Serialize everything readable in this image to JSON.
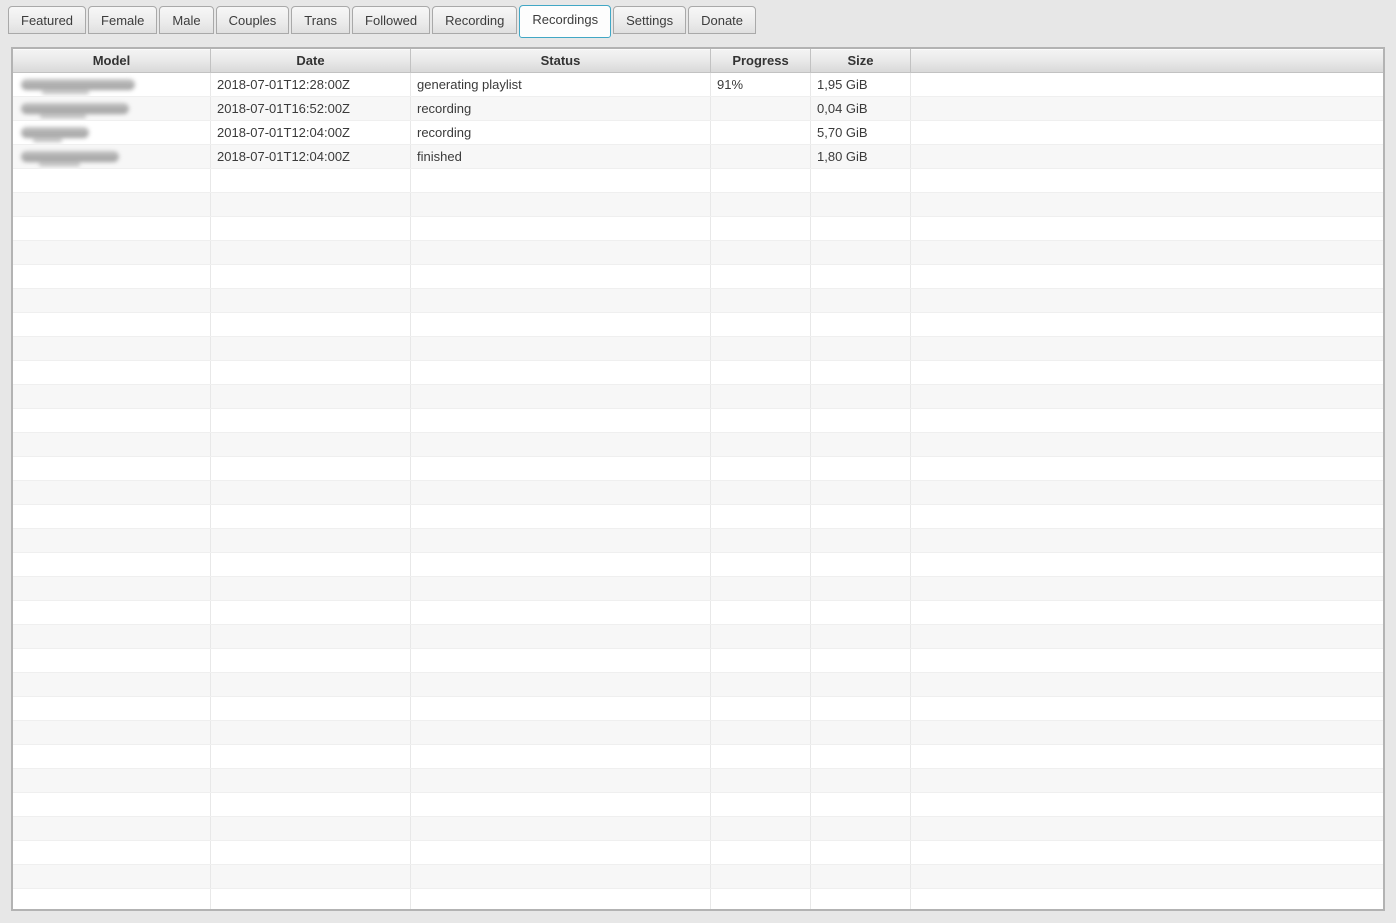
{
  "colors": {
    "accent_active_tab_border": "#41a7c5",
    "stripe_row": "#f7f7f7",
    "table_border": "#b3b3b3",
    "page_background": "#e7e7e7"
  },
  "tabs": {
    "items": [
      {
        "label": "Featured",
        "active": false
      },
      {
        "label": "Female",
        "active": false
      },
      {
        "label": "Male",
        "active": false
      },
      {
        "label": "Couples",
        "active": false
      },
      {
        "label": "Trans",
        "active": false
      },
      {
        "label": "Followed",
        "active": false
      },
      {
        "label": "Recording",
        "active": false
      },
      {
        "label": "Recordings",
        "active": true
      },
      {
        "label": "Settings",
        "active": false
      },
      {
        "label": "Donate",
        "active": false
      }
    ]
  },
  "table": {
    "columns": [
      {
        "key": "model",
        "label": "Model"
      },
      {
        "key": "date",
        "label": "Date"
      },
      {
        "key": "status",
        "label": "Status"
      },
      {
        "key": "progress",
        "label": "Progress"
      },
      {
        "key": "size",
        "label": "Size"
      },
      {
        "key": "extra",
        "label": ""
      }
    ],
    "rows": [
      {
        "model_redacted": true,
        "redact_width": 114,
        "date": "2018-07-01T12:28:00Z",
        "status": "generating playlist",
        "progress": "91%",
        "size": "1,95 GiB",
        "extra": ""
      },
      {
        "model_redacted": true,
        "redact_width": 108,
        "date": "2018-07-01T16:52:00Z",
        "status": "recording",
        "progress": "",
        "size": "0,04 GiB",
        "extra": ""
      },
      {
        "model_redacted": true,
        "redact_width": 68,
        "date": "2018-07-01T12:04:00Z",
        "status": "recording",
        "progress": "",
        "size": "5,70 GiB",
        "extra": ""
      },
      {
        "model_redacted": true,
        "redact_width": 98,
        "date": "2018-07-01T12:04:00Z",
        "status": "finished",
        "progress": "",
        "size": "1,80 GiB",
        "extra": ""
      }
    ],
    "empty_row_count": 31
  }
}
